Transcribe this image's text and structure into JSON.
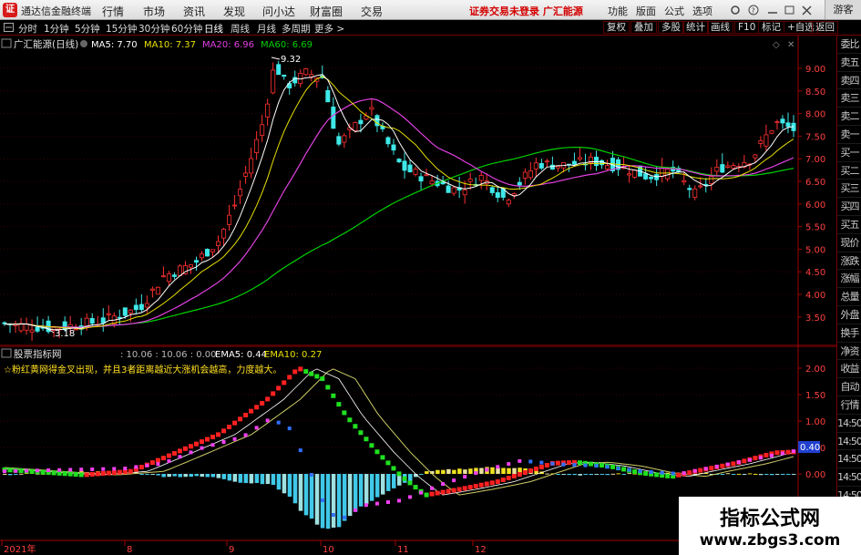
{
  "menubar": {
    "logo_glyph": "证",
    "app_title": "通达信金融终端",
    "menus": [
      "行情",
      "市场",
      "资讯",
      "发现",
      "问小达",
      "财富圈",
      "交易"
    ],
    "warning": "证券交易未登录  广汇能源",
    "right_items": [
      "功能",
      "版面",
      "公式",
      "选项"
    ],
    "guest": "游客"
  },
  "toolbar": {
    "periods": [
      "分时",
      "1分钟",
      "5分钟",
      "15分钟",
      "30分钟",
      "60分钟",
      "日线",
      "周线",
      "月线",
      "多周期",
      "更多 >"
    ],
    "right_buttons": [
      "复权",
      "叠加",
      "多股",
      "统计",
      "画线",
      "F10",
      "标记",
      "+自选",
      "返回"
    ]
  },
  "main_panel": {
    "stock_name": "广汇能源(日线)",
    "ma5": "MA5: 7.70",
    "ma10": "MA10: 7.37",
    "ma20": "MA20: 6.96",
    "ma60": "MA60: 6.69",
    "high_label": "9.32",
    "low_label": "3.18",
    "price_ticks": [
      "9.00",
      "8.50",
      "8.00",
      "7.50",
      "7.00",
      "6.50",
      "6.00",
      "5.50",
      "5.00",
      "4.50",
      "4.00",
      "3.50"
    ],
    "colors": {
      "ma5": "#ffffff",
      "ma10": "#e8e000",
      "ma20": "#e040e0",
      "ma60": "#00d000",
      "up": "#ff3030",
      "down": "#3fe8e8",
      "axis": "#ff3030"
    }
  },
  "sub_panel": {
    "indicator_name": "股票指标网",
    "readout": ": 10.06 : 10.06 : 0.00",
    "ema5": "EMA5: 0.44",
    "ema10": "EMA10: 0.27",
    "note": "☆粉红黄网得金叉出现，并且3者距离越近大涨机会越高，力度越大。",
    "value_ticks": [
      "2.00",
      "1.50",
      "1.00",
      "0.50",
      "0.00"
    ],
    "current_value": "0.40",
    "date_ticks": [
      "2021年",
      "8",
      "9",
      "10",
      "11",
      "12"
    ]
  },
  "sidepanel": {
    "items": [
      "委比",
      "卖五",
      "卖四",
      "卖三",
      "卖二",
      "卖一",
      "买一",
      "买二",
      "买三",
      "买四",
      "买五",
      "现价",
      "涨跌",
      "涨幅",
      "总量",
      "外盘",
      "换手",
      "净资",
      "收益",
      "自动",
      "行情",
      "14:50",
      "14:50",
      "14:50",
      "14:50",
      "14:50",
      "14:50",
      "14:50",
      "14:50"
    ]
  },
  "watermark": {
    "line1": "指标公式网",
    "line2": "www.zbgs3.com"
  }
}
